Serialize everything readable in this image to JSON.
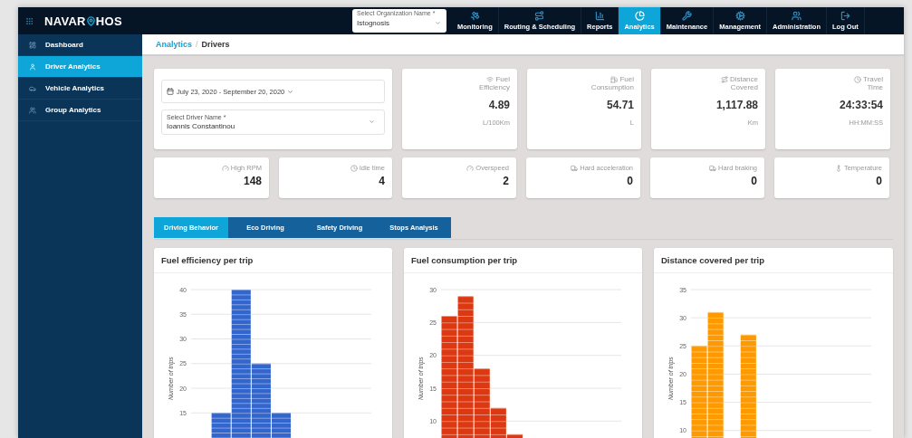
{
  "logo": {
    "left": "NAVAR",
    "right": "HOS"
  },
  "org_select": {
    "label": "Select Organization Name *",
    "value": "Istognosis"
  },
  "nav": [
    {
      "label": "Monitoring",
      "selected": false
    },
    {
      "label": "Routing & Scheduling",
      "selected": false
    },
    {
      "label": "Reports",
      "selected": false
    },
    {
      "label": "Analytics",
      "selected": true
    },
    {
      "label": "Maintenance",
      "selected": false
    },
    {
      "label": "Management",
      "selected": false
    },
    {
      "label": "Administration",
      "selected": false
    },
    {
      "label": "Log Out",
      "selected": false
    }
  ],
  "sidebar": {
    "items": [
      {
        "label": "Dashboard",
        "selected": false
      },
      {
        "label": "Driver Analytics",
        "selected": true
      },
      {
        "label": "Vehicle Analytics",
        "selected": false
      },
      {
        "label": "Group Analytics",
        "selected": false
      }
    ]
  },
  "breadcrumb": {
    "parent": "Analytics",
    "separator": "/",
    "current": "Drivers"
  },
  "filters": {
    "date_range": "July 23, 2020 - September 20, 2020",
    "driver_label": "Select Driver Name *",
    "driver": "Ioannis Constantinou"
  },
  "kpis": [
    {
      "label": "Fuel",
      "label_2": "Efficiency",
      "value": "4.89",
      "unit": "L/100Km"
    },
    {
      "label": "Fuel",
      "label_2": "Consumption",
      "value": "54.71",
      "unit": "L"
    },
    {
      "label": "Distance",
      "label_2": "Covered",
      "value": "1,117.88",
      "unit": "Km"
    },
    {
      "label": "Travel",
      "label_2": "Time",
      "value": "24:33:54",
      "unit": "HH:MM:SS"
    }
  ],
  "counters": [
    {
      "label": "High RPM",
      "value": "148"
    },
    {
      "label": "Idle time",
      "value": "4"
    },
    {
      "label": "Overspeed",
      "value": "2"
    },
    {
      "label": "Hard acceleration",
      "value": "0"
    },
    {
      "label": "Hard braking",
      "value": "0"
    },
    {
      "label": "Temperature",
      "value": "0"
    }
  ],
  "tabs": [
    {
      "label": "Driving Behavior",
      "selected": true
    },
    {
      "label": "Eco Driving",
      "selected": false
    },
    {
      "label": "Safety Driving",
      "selected": false
    },
    {
      "label": "Stops Analysis",
      "selected": false
    }
  ],
  "charts": [
    {
      "title": "Fuel efficiency per trip",
      "chart_data": {
        "type": "bar",
        "ylabel": "Number of trips",
        "grid": true,
        "ylim": [
          0,
          40
        ],
        "yticks": [
          15,
          20,
          25,
          30,
          35,
          40
        ],
        "series": [
          {
            "color": "#3366cc",
            "values": [
              0,
              15,
              40,
              25,
              15,
              0,
              0,
              0,
              0
            ]
          }
        ]
      }
    },
    {
      "title": "Fuel consumption per trip",
      "chart_data": {
        "type": "bar",
        "ylabel": "Number of trips",
        "grid": true,
        "ylim": [
          0,
          30
        ],
        "yticks": [
          10,
          15,
          20,
          25,
          30
        ],
        "series": [
          {
            "color": "#dc3912",
            "values": [
              26,
              29,
              18,
              12,
              8,
              0,
              0,
              0,
              0,
              0,
              0
            ]
          }
        ]
      }
    },
    {
      "title": "Distance covered per trip",
      "chart_data": {
        "type": "bar",
        "ylabel": "Number of trips",
        "grid": true,
        "ylim": [
          0,
          35
        ],
        "yticks": [
          10,
          15,
          20,
          25,
          30,
          35
        ],
        "series": [
          {
            "color": "#ff9900",
            "values": [
              25,
              31,
              0,
              27,
              0,
              0,
              0,
              0,
              0,
              0,
              0
            ]
          }
        ]
      }
    }
  ]
}
